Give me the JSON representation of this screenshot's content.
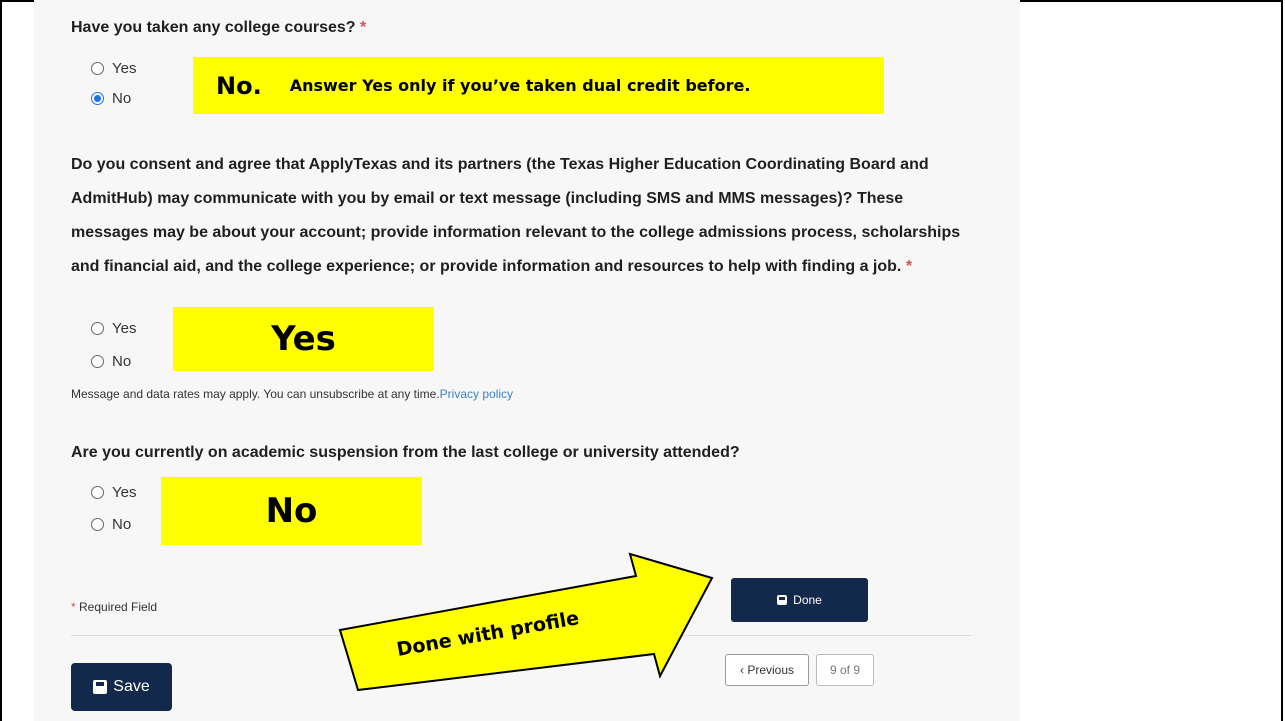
{
  "questions": {
    "q1": {
      "text": "Have you taken any college courses?",
      "required": "*",
      "options": [
        "Yes",
        "No"
      ],
      "selected": "No"
    },
    "q2": {
      "text": "Do you consent and agree that ApplyTexas and its partners (the Texas Higher Education Coordinating Board and AdmitHub) may communicate with you by email or text message (including SMS and MMS messages)? These messages may be about your account; provide information relevant to the college admissions process, scholarships and financial aid, and the college experience; or provide information and resources to help with finding a job.",
      "required": "*",
      "options": [
        "Yes",
        "No"
      ],
      "note": "Message and data rates may apply. You can unsubscribe at any time.",
      "privacy_link": "Privacy policy"
    },
    "q3": {
      "text": "Are you currently on academic suspension from the last college or university attended?",
      "options": [
        "Yes",
        "No"
      ]
    }
  },
  "annotations": {
    "q1_answer": "No.",
    "q1_hint": "Answer Yes only if you’ve taken dual credit before.",
    "q2_answer": "Yes",
    "q3_answer": "No",
    "arrow_text": "Done with profile"
  },
  "footer": {
    "required_star": "*",
    "required_text": "Required Field",
    "done_label": "Done",
    "save_label": "Save",
    "previous_label": "‹ Previous",
    "page_indicator": "9 of 9"
  },
  "colors": {
    "highlight": "#ffff00",
    "button_navy": "#13294b",
    "required_red": "#d9534f",
    "radio_blue": "#1a73e8"
  }
}
